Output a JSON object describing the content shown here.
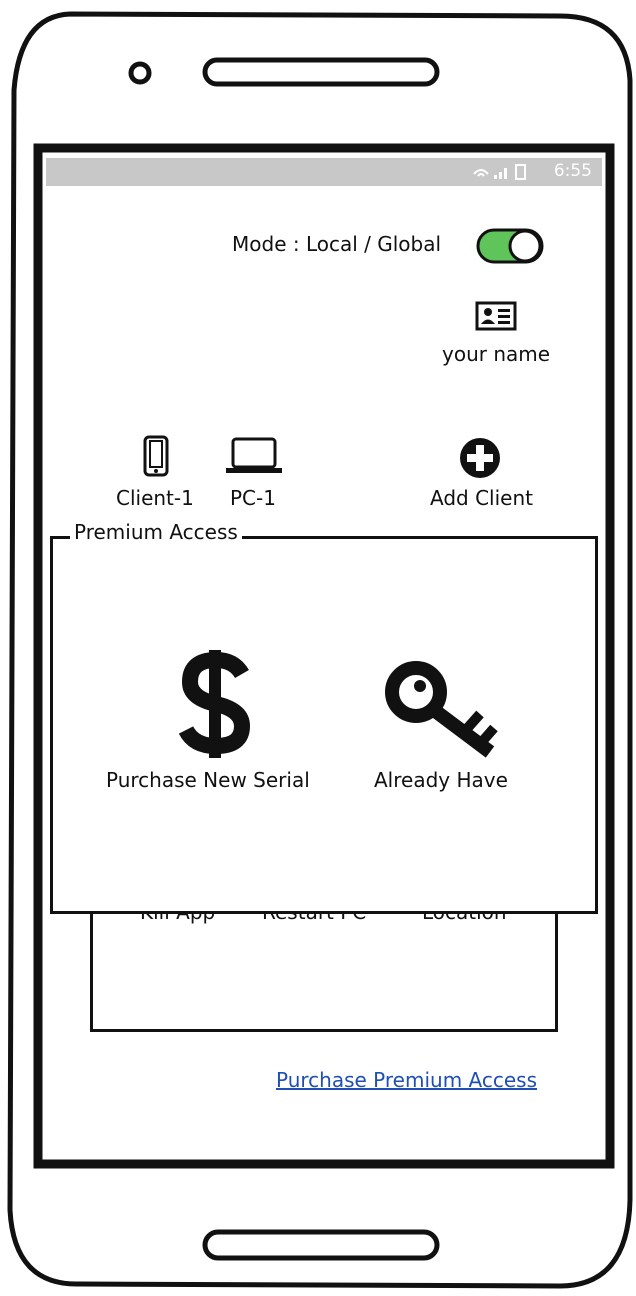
{
  "status_bar": {
    "time": "6:55",
    "icons": [
      "wifi-icon",
      "signal-icon",
      "battery-icon"
    ]
  },
  "header": {
    "mode_label": "Mode : Local / Global",
    "mode_toggle_on": true,
    "user_name": "your name"
  },
  "clients": [
    {
      "label": "Client-1",
      "icon": "phone-icon"
    },
    {
      "label": "PC-1",
      "icon": "laptop-icon"
    }
  ],
  "add_client_label": "Add Client",
  "premium": {
    "legend": "Premium Access",
    "purchase_label": "Purchase New Serial",
    "already_label": "Already Have"
  },
  "hidden_actions": [
    "Kill App",
    "Restart PC",
    "Location"
  ],
  "footer_link": "Purchase Premium Access",
  "colors": {
    "toggle_on": "#5fc45a",
    "link": "#1f4fb5",
    "status_bar": "#c8c8c8"
  }
}
